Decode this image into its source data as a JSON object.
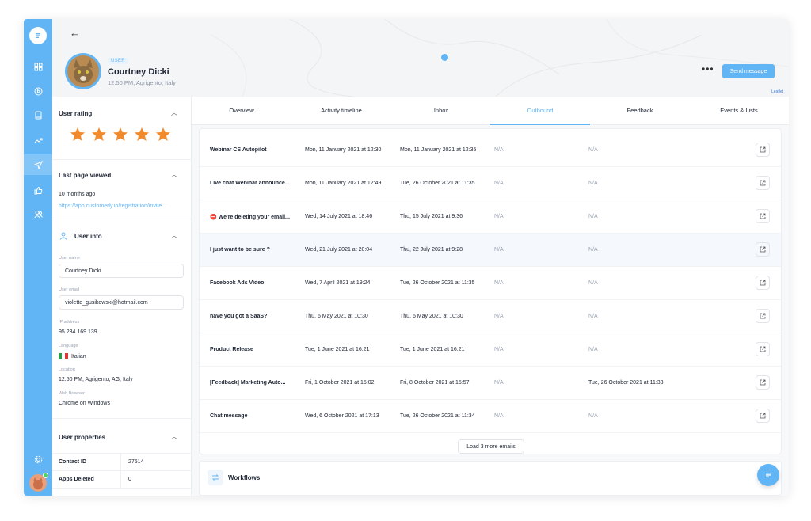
{
  "sidebar": {
    "icons": [
      "logo-icon",
      "grid-icon",
      "play-icon",
      "book-icon",
      "trend-icon",
      "send-icon",
      "thumbs-up-icon",
      "users-icon"
    ],
    "settings_icon": "gear-icon"
  },
  "header": {
    "back_icon": "←",
    "badge": "USER",
    "name": "Courtney Dicki",
    "location": "12:50 PM, Agrigento, Italy",
    "more": "•••",
    "send_message": "Send message",
    "map_attribution": "Leaflet"
  },
  "left": {
    "rating": {
      "title": "User rating",
      "stars": 5
    },
    "last_page": {
      "title": "Last page viewed",
      "when": "10 months ago",
      "url": "https://app.customerly.io/registration/invite..."
    },
    "user_info": {
      "title": "User info",
      "name_label": "User name",
      "name_value": "Courtney Dicki",
      "email_label": "User email",
      "email_value": "violette_gusikowski@hotmail.com",
      "ip_label": "IP address",
      "ip_value": "95.234.169.139",
      "language_label": "Language",
      "language_value": "Italian",
      "location_label": "Location",
      "location_value": "12:50 PM, Agrigento, AG, Italy",
      "browser_label": "Web Browser",
      "browser_value": "Chrome on Windows"
    },
    "properties": {
      "title": "User properties",
      "rows": [
        {
          "key": "Contact ID",
          "value": "27514"
        },
        {
          "key": "Apps Deleted",
          "value": "0"
        }
      ]
    }
  },
  "tabs": [
    "Overview",
    "Activity timeline",
    "Inbox",
    "Outbound",
    "Feedback",
    "Events & Lists"
  ],
  "active_tab": "Outbound",
  "emails": [
    {
      "name": "Webinar CS Autopilot",
      "d1": "Mon, 11 January 2021 at 12:30",
      "d2": "Mon, 11 January 2021 at 12:35",
      "d3": "N/A",
      "d4": "N/A"
    },
    {
      "name": "Live chat Webinar announce...",
      "d1": "Mon, 11 January 2021 at 12:49",
      "d2": "Tue, 26 October 2021 at 11:35",
      "d3": "N/A",
      "d4": "N/A"
    },
    {
      "name": "⛔ We're deleting your email...",
      "d1": "Wed, 14 July 2021 at 18:46",
      "d2": "Thu, 15 July 2021 at 9:36",
      "d3": "N/A",
      "d4": "N/A"
    },
    {
      "name": "I just want to be sure ?",
      "d1": "Wed, 21 July 2021 at 20:04",
      "d2": "Thu, 22 July 2021 at 9:28",
      "d3": "N/A",
      "d4": "N/A"
    },
    {
      "name": "Facebook Ads Video",
      "d1": "Wed, 7 April 2021 at 19:24",
      "d2": "Tue, 26 October 2021 at 11:35",
      "d3": "N/A",
      "d4": "N/A"
    },
    {
      "name": "have you got a SaaS?",
      "d1": "Thu, 6 May 2021 at 10:30",
      "d2": "Thu, 6 May 2021 at 10:30",
      "d3": "N/A",
      "d4": "N/A"
    },
    {
      "name": "Product Release",
      "d1": "Tue, 1 June 2021 at 16:21",
      "d2": "Tue, 1 June 2021 at 16:21",
      "d3": "N/A",
      "d4": "N/A"
    },
    {
      "name": "[Feedback] Marketing Auto...",
      "d1": "Fri, 1 October 2021 at 15:02",
      "d2": "Fri, 8 October 2021 at 15:57",
      "d3": "N/A",
      "d4": "Tue, 26 October 2021 at 11:33"
    },
    {
      "name": "Chat message",
      "d1": "Wed, 6 October 2021 at 17:13",
      "d2": "Tue, 26 October 2021 at 11:34",
      "d3": "N/A",
      "d4": "N/A"
    }
  ],
  "load_more": "Load 3 more emails",
  "workflows": {
    "title": "Workflows"
  },
  "colors": {
    "accent": "#62b5f5",
    "star": "#f08a2c"
  }
}
